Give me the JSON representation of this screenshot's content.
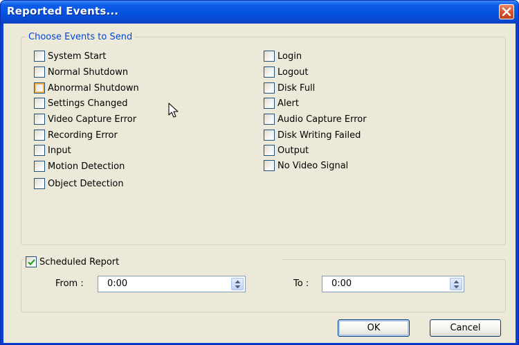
{
  "window": {
    "title": "Reported Events...",
    "close_icon": "close-icon"
  },
  "events_group": {
    "legend": "Choose Events to Send",
    "left_column": [
      {
        "label": "System Start",
        "checked": false
      },
      {
        "label": "Normal Shutdown",
        "checked": false
      },
      {
        "label": "Abnormal Shutdown",
        "checked": false,
        "hover": true
      },
      {
        "label": "Settings Changed",
        "checked": false
      },
      {
        "label": "Video Capture Error",
        "checked": false
      },
      {
        "label": "Recording Error",
        "checked": false
      },
      {
        "label": "Input",
        "checked": false
      },
      {
        "label": "Motion Detection",
        "checked": false
      },
      {
        "label": "Object Detection",
        "checked": false
      }
    ],
    "right_column": [
      {
        "label": "Login",
        "checked": false
      },
      {
        "label": "Logout",
        "checked": false
      },
      {
        "label": "Disk Full",
        "checked": false
      },
      {
        "label": "Alert",
        "checked": false
      },
      {
        "label": "Audio Capture Error",
        "checked": false
      },
      {
        "label": "Disk Writing Failed",
        "checked": false
      },
      {
        "label": "Output",
        "checked": false
      },
      {
        "label": "No Video Signal",
        "checked": false
      }
    ]
  },
  "schedule": {
    "label": "Scheduled Report",
    "checked": true,
    "from_label": "From :",
    "from_value": "0:00",
    "to_label": "To :",
    "to_value": "0:00"
  },
  "buttons": {
    "ok": "OK",
    "cancel": "Cancel"
  },
  "colors": {
    "titlebar": "#0553e1",
    "dialog_bg": "#ece9d8",
    "legend_text": "#0046d5",
    "check_green": "#21a121"
  }
}
